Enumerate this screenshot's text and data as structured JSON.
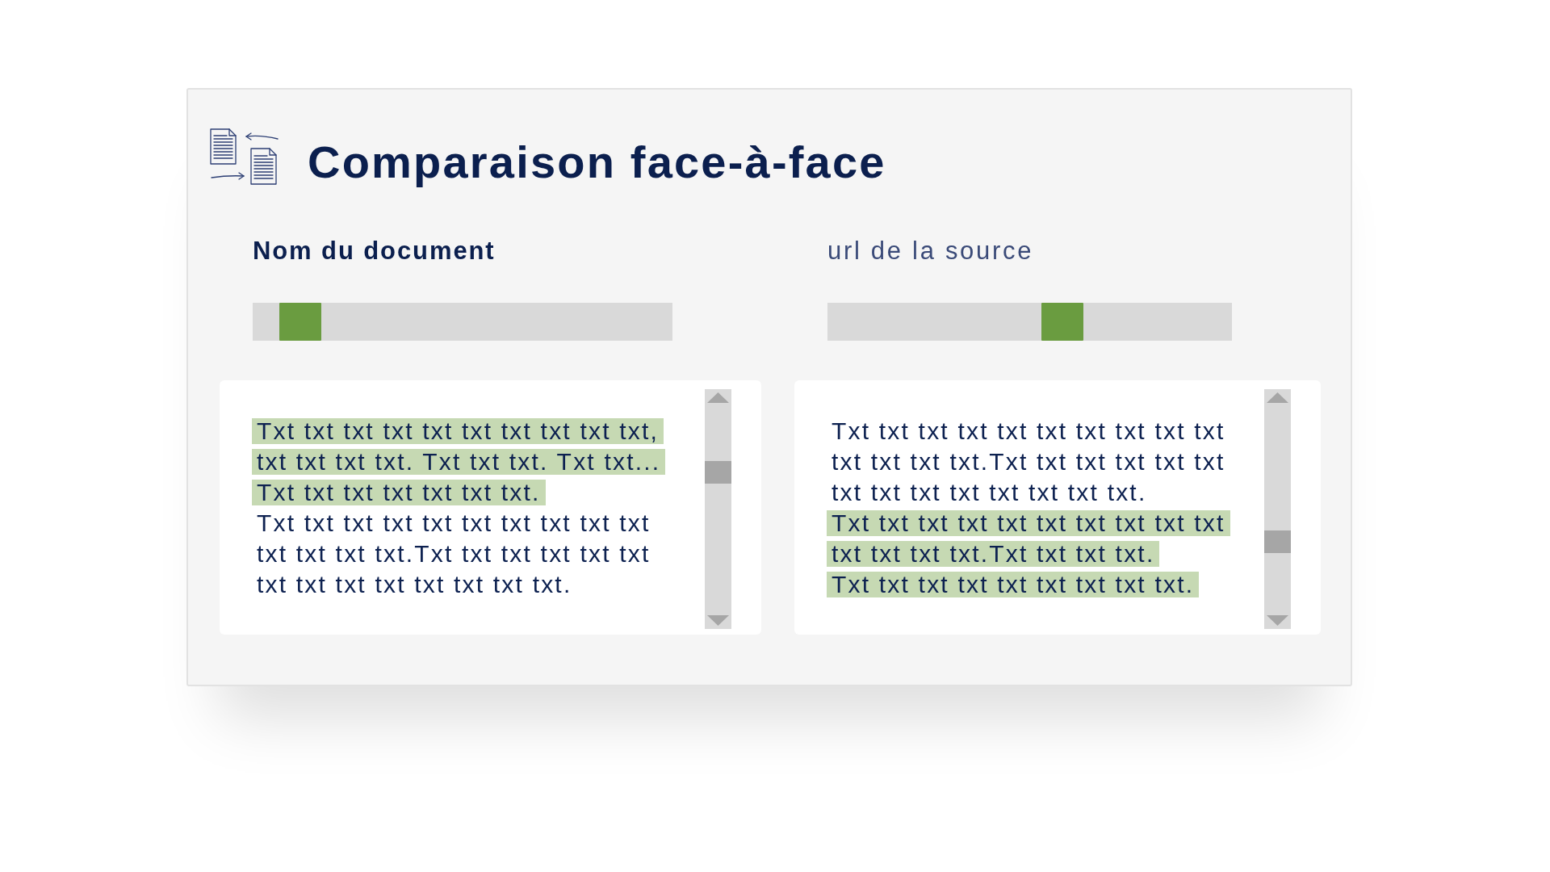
{
  "header": {
    "title": "Comparaison face-à-face"
  },
  "columns": [
    {
      "kind": "document",
      "label": "Nom du document",
      "slider": {
        "level": 0.07
      },
      "lines": [
        {
          "text": "Txt txt txt txt txt txt txt txt txt txt,",
          "highlighted": true
        },
        {
          "text": "txt txt txt txt. Txt txt txt. Txt txt...",
          "highlighted": true
        },
        {
          "text": "Txt txt txt txt txt txt txt.",
          "highlighted": true
        },
        {
          "text": "Txt txt txt txt txt txt txt txt txt txt",
          "highlighted": false
        },
        {
          "text": "txt txt txt txt.Txt txt txt txt txt txt",
          "highlighted": false
        },
        {
          "text": "txt txt txt txt txt txt txt txt.",
          "highlighted": false
        }
      ]
    },
    {
      "kind": "source",
      "label": "url de la source",
      "slider": {
        "level": 0.59
      },
      "lines": [
        {
          "text": "Txt txt txt txt txt txt txt txt txt txt",
          "highlighted": false
        },
        {
          "text": "txt txt txt txt.Txt txt txt txt txt txt",
          "highlighted": false
        },
        {
          "text": "txt txt txt txt txt txt txt txt.",
          "highlighted": false
        },
        {
          "text": "Txt txt txt txt txt txt txt txt txt txt",
          "highlighted": true
        },
        {
          "text": "txt txt txt txt.Txt txt txt txt.",
          "highlighted": true
        },
        {
          "text": "Txt txt txt txt txt txt txt txt txt.",
          "highlighted": true
        }
      ]
    }
  ]
}
